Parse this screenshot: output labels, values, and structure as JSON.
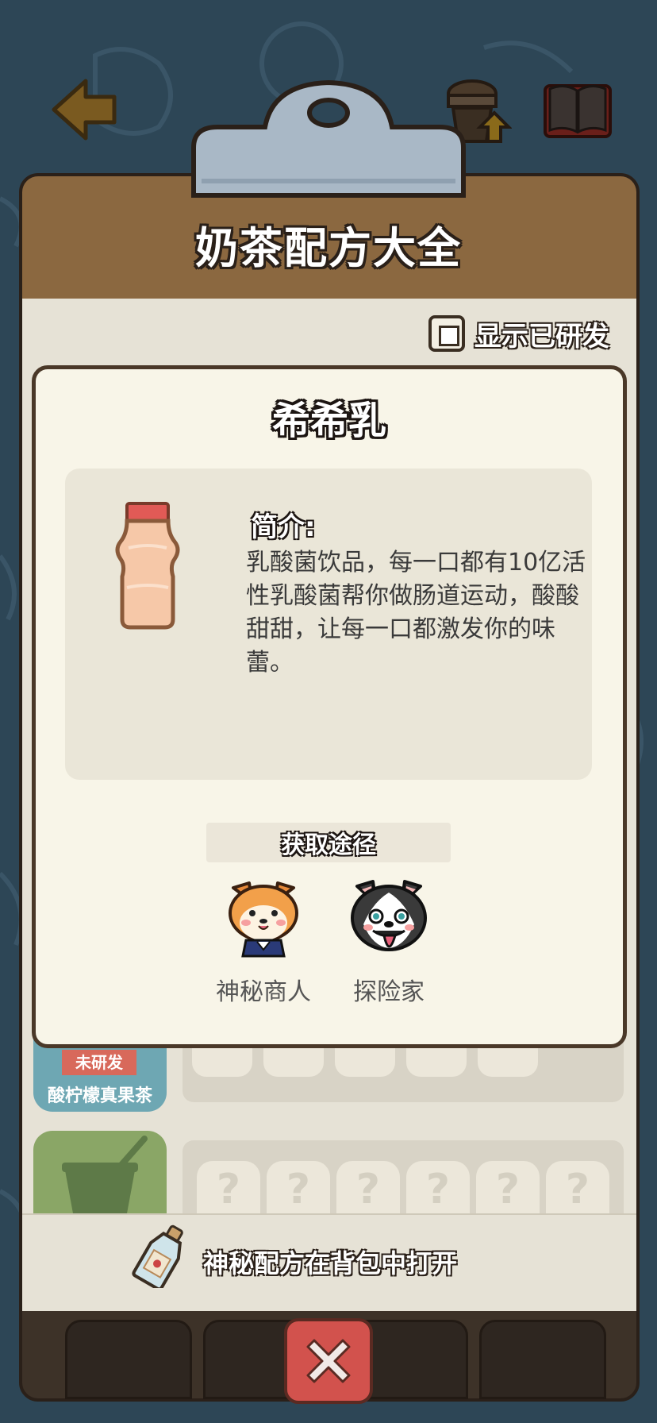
{
  "header": {
    "title": "奶茶配方大全",
    "back_icon": "back-arrow-icon",
    "upgrade_icon": "upgrade-icon",
    "book_icon": "book-icon"
  },
  "filter": {
    "show_developed_label": "显示已研发",
    "checked": false
  },
  "list": {
    "items": [
      {
        "status": "未研发",
        "name": "酸柠檬真果茶"
      }
    ],
    "locked_placeholder": "?"
  },
  "footer": {
    "hint": "神秘配方在背包中打开"
  },
  "popup": {
    "title": "希希乳",
    "intro_label": "简介:",
    "description": "乳酸菌饮品，每一口都有10亿活性乳酸菌帮你做肠道运动，酸酸甜甜，让每一口都激发你的味蕾。",
    "source_header": "获取途径",
    "sources": [
      {
        "label": "神秘商人",
        "icon": "shiba-merchant-icon"
      },
      {
        "label": "探险家",
        "icon": "husky-explorer-icon"
      }
    ]
  },
  "colors": {
    "background": "#2d4656",
    "header_brown": "#8b6840",
    "close_red": "#d2524d",
    "tag_red": "#d8695b"
  }
}
